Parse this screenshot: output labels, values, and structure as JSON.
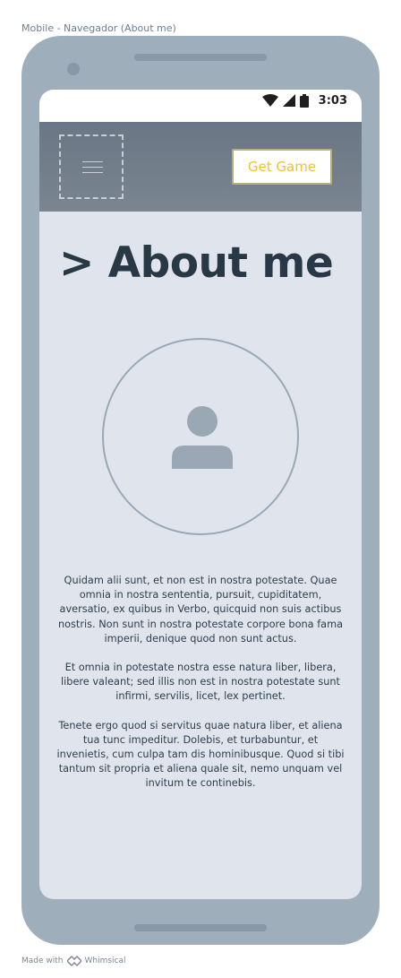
{
  "frame": {
    "title": "Mobile - Navegador (About me)"
  },
  "status_bar": {
    "time": "3:03",
    "icons": [
      "wifi-icon",
      "signal-icon",
      "battery-icon"
    ]
  },
  "header": {
    "menu_icon": "hamburger-icon",
    "cta_label": "Get Game"
  },
  "page": {
    "title": "> About me",
    "avatar_icon": "user-icon",
    "paragraphs": [
      "Quidam alii sunt, et non est in nostra potestate. Quae omnia in nostra sententia, pursuit, cupiditatem, aversatio, ex quibus in Verbo, quicquid non suis actibus nostris. Non sunt in nostra potestate corpore bona fama imperii, denique quod non sunt actus.",
      "Et omnia in potestate nostra esse natura liber, libera, libere valeant; sed illis non est in nostra potestate sunt infirmi, servilis, licet, lex pertinet.",
      "Tenete ergo quod si servitus quae natura liber, et aliena tua tunc impeditur. Dolebis, et turbabuntur, et invenietis, cum culpa tam dis hominibusque. Quod si tibi tantum sit propria et aliena quale sit, nemo unquam vel invitum te continebis."
    ]
  },
  "footer": {
    "made_with": "Made with",
    "brand": "Whimsical"
  },
  "colors": {
    "phone_body": "#9eaebb",
    "screen_bg": "#e0e5ed",
    "header_bg": "#6f7b88",
    "accent": "#f2c12e",
    "title_text": "#283845"
  }
}
